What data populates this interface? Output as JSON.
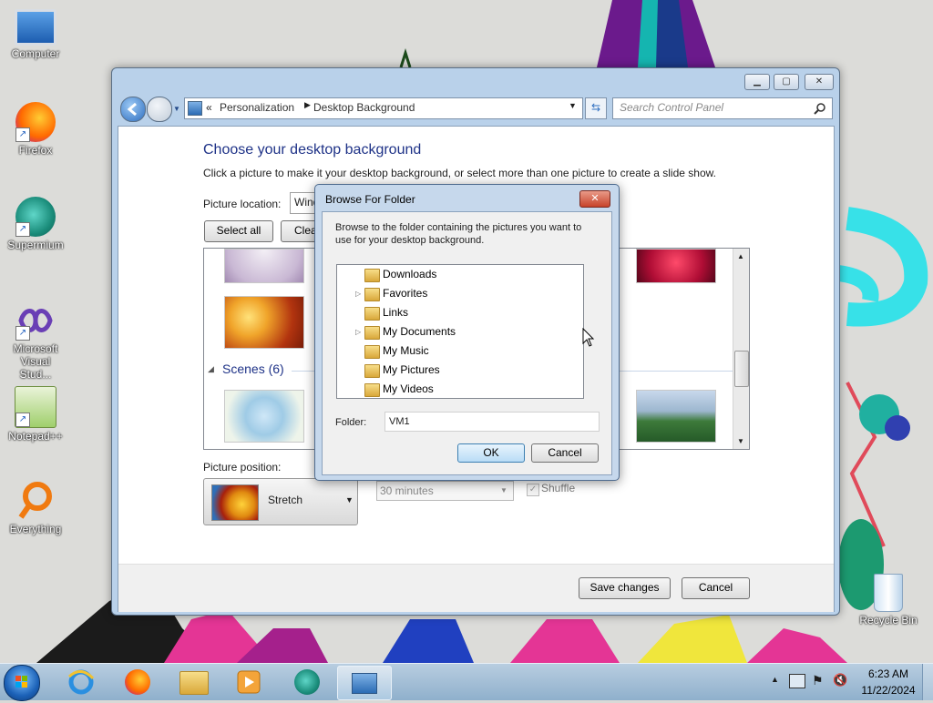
{
  "desktop": {
    "icons": [
      {
        "label": "Computer"
      },
      {
        "label": "Firefox"
      },
      {
        "label": "Supermium"
      },
      {
        "label": "Microsoft Visual Stud..."
      },
      {
        "label": "Notepad++"
      },
      {
        "label": "Everything"
      },
      {
        "label": "Recycle Bin"
      }
    ]
  },
  "window": {
    "address": {
      "breadcrumb_sep": "«",
      "crumb1": "Personalization",
      "crumb2": "Desktop Background"
    },
    "search_placeholder": "Search Control Panel",
    "heading": "Choose your desktop background",
    "description": "Click a picture to make it your desktop background, or select more than one picture to create a slide show.",
    "picture_location_label": "Picture location:",
    "picture_location_value": "Wind",
    "select_all": "Select all",
    "clear_all": "Clea",
    "group_scenes": "Scenes (6)",
    "picture_position_label": "Picture position:",
    "picture_position_value": "Stretch",
    "interval_value": "30 minutes",
    "shuffle_label": "Shuffle",
    "save_changes": "Save changes",
    "cancel": "Cancel"
  },
  "dialog": {
    "title": "Browse For Folder",
    "close_glyph": "✕",
    "instructions": "Browse to the folder containing the pictures you want to use for your desktop background.",
    "tree": [
      {
        "label": "Downloads",
        "expandable": false
      },
      {
        "label": "Favorites",
        "expandable": true
      },
      {
        "label": "Links",
        "expandable": false
      },
      {
        "label": "My Documents",
        "expandable": true
      },
      {
        "label": "My Music",
        "expandable": false
      },
      {
        "label": "My Pictures",
        "expandable": false
      },
      {
        "label": "My Videos",
        "expandable": false
      }
    ],
    "folder_label": "Folder:",
    "folder_value": "VM1",
    "ok": "OK",
    "cancel": "Cancel"
  },
  "taskbar": {
    "time": "6:23 AM",
    "date": "11/22/2024"
  },
  "colors": {
    "heading": "#1e3287",
    "group": "#1e3287",
    "accent_blue": "#3c7fb1"
  }
}
